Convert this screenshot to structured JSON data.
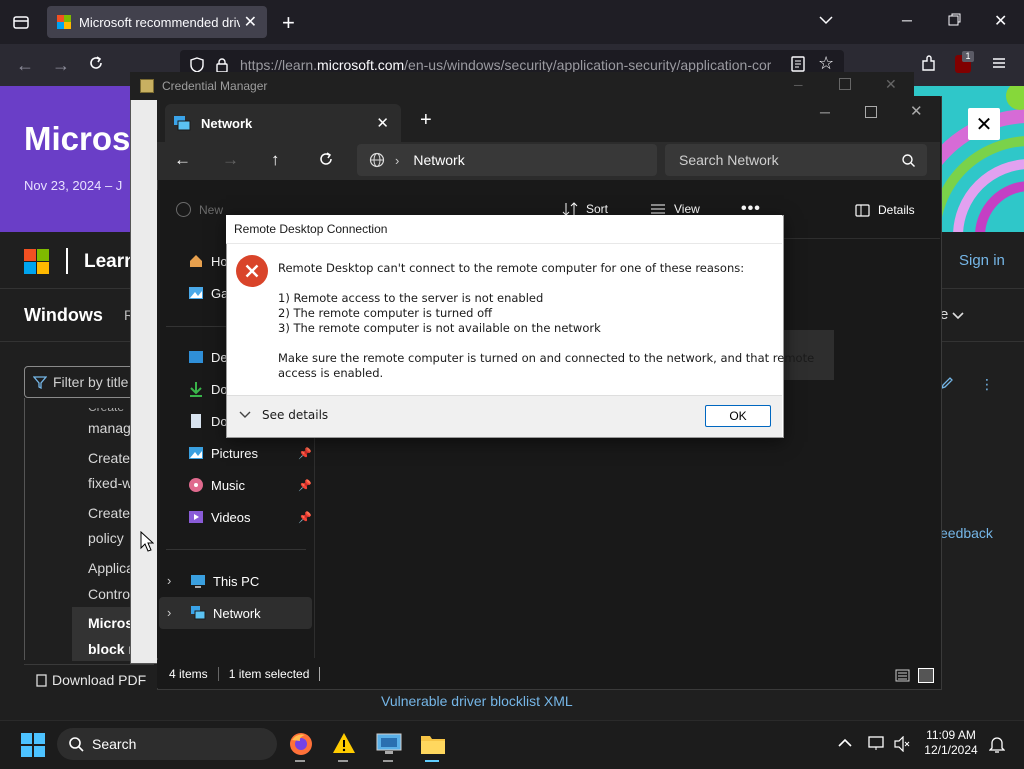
{
  "browser": {
    "tab_title": "Microsoft recommended driver",
    "url_prefix": "https://learn.",
    "url_domain": "microsoft.com",
    "url_suffix": "/en-us/windows/security/application-security/application-cor",
    "notif_count": "1"
  },
  "page": {
    "hero_title": "Microsof",
    "hero_date": "Nov 23, 2024 – J",
    "learn": "Learn",
    "sign_in": "Sign in",
    "windows": "Windows",
    "windows_r": "R",
    "e_label": "e",
    "filter_placeholder": "Filter by title",
    "toc": [
      "manag",
      "Create",
      "fixed-w",
      "Create",
      "policy",
      "Applica",
      "Contro",
      "Micros",
      "block r"
    ],
    "toc_top": "Create",
    "download_pdf": "Download PDF",
    "vuln_link": "Vulnerable driver blocklist XML",
    "feedback": "eedback"
  },
  "credman": {
    "title": "Credential Manager"
  },
  "explorer": {
    "tab_title": "Network",
    "breadcrumb": "Network",
    "search_placeholder": "Search Network",
    "cmd": {
      "new": "New",
      "sort": "Sort",
      "view": "View",
      "details": "Details"
    },
    "nav": [
      {
        "label": "Ho",
        "icon": "home-icon"
      },
      {
        "label": "Ga",
        "icon": "gallery-icon"
      },
      {
        "label": "De",
        "icon": "desktop-icon"
      },
      {
        "label": "Do",
        "icon": "downloads-icon"
      },
      {
        "label": "Do",
        "icon": "documents-icon"
      },
      {
        "label": "Pictures",
        "icon": "pictures-icon"
      },
      {
        "label": "Music",
        "icon": "music-icon"
      },
      {
        "label": "Videos",
        "icon": "videos-icon"
      },
      {
        "label": "This PC",
        "icon": "computer-icon"
      },
      {
        "label": "Network",
        "icon": "network-icon"
      }
    ],
    "status_items": "4 items",
    "status_selected": "1 item selected"
  },
  "dialog": {
    "title": "Remote Desktop Connection",
    "heading": "Remote Desktop can't connect to the remote computer for one of these reasons:",
    "reasons": [
      "1) Remote access to the server is not enabled",
      "2) The remote computer is turned off",
      "3) The remote computer is not available on the network"
    ],
    "advice_line1": "Make sure the remote computer is turned on and connected to the network, and that remote",
    "advice_line2": "access is enabled.",
    "see_details": "See details",
    "ok": "OK"
  },
  "taskbar": {
    "search": "Search",
    "time": "11:09 AM",
    "date": "12/1/2024"
  },
  "colors": {
    "accent": "#0067c0",
    "error": "#d9442a",
    "hero": "#6a3ec7",
    "link": "#75b6e7"
  }
}
